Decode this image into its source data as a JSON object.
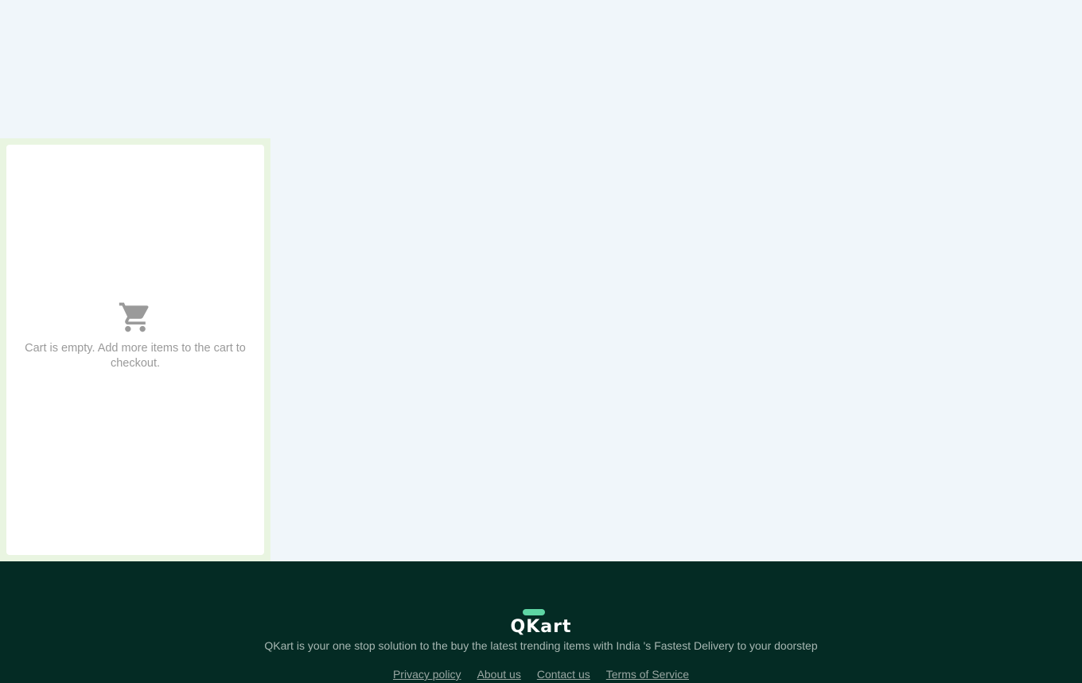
{
  "cart": {
    "empty_message": "Cart is empty. Add more items to the cart to checkout."
  },
  "footer": {
    "brand": "QKart",
    "tagline": "QKart is your one stop solution to the buy the latest trending items with India 's Fastest Delivery to your doorstep",
    "links": [
      "Privacy policy",
      "About us",
      "Contact us",
      "Terms of Service"
    ]
  },
  "colors": {
    "page_background": "#f0f6fa",
    "cart_panel_background": "#e9f5e1",
    "footer_background": "#042b24",
    "brand_accent": "#5ed5a4"
  },
  "icons": {
    "cart": "shopping-cart-icon"
  }
}
